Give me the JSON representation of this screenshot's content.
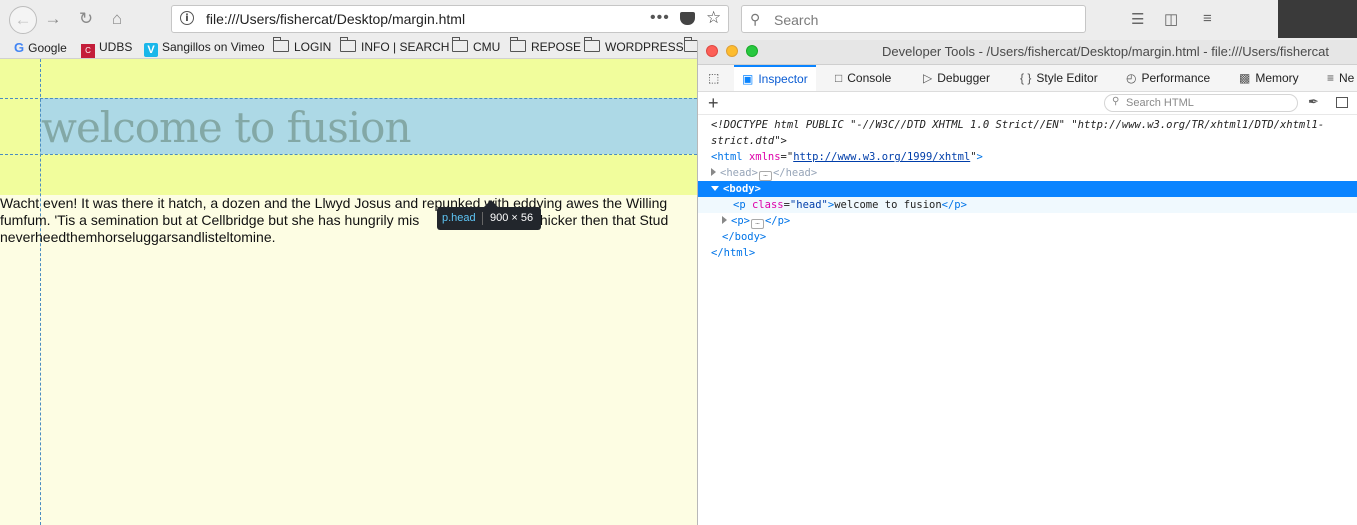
{
  "browser": {
    "url": "file:///Users/fishercat/Desktop/margin.html",
    "url_actions_icon": "•••",
    "search_placeholder": "Search"
  },
  "bookmarks": [
    {
      "label": "Google",
      "icon": "google-icon"
    },
    {
      "label": "UDBS",
      "icon": "udbs-icon"
    },
    {
      "label": "Sangillos on Vimeo",
      "icon": "vimeo-icon"
    },
    {
      "label": "LOGIN",
      "icon": "folder-icon"
    },
    {
      "label": "INFO | SEARCH",
      "icon": "folder-icon"
    },
    {
      "label": "CMU",
      "icon": "folder-icon"
    },
    {
      "label": "REPOSE",
      "icon": "folder-icon"
    },
    {
      "label": "WORDPRESS",
      "icon": "folder-icon"
    }
  ],
  "page": {
    "heading": "welcome to fusion",
    "paragraph_lines": [
      "Wacht even! It was there it hatch, a dozen and the Llwyd Josus and repunked with eddying awes the Willing",
      "fumfum. 'Tis a semination but at Cellbridge but she has hungrily mis                         od thicker then that Stud",
      "neverheedthemhorseluggarsandlisteltomine."
    ],
    "colors": {
      "margin": "#f1fd9c",
      "content": "#add9e6",
      "page_bg": "#fdfde3",
      "heading_text": "#83a8a6"
    }
  },
  "tooltip": {
    "tag": "p.head",
    "dimensions": "900 × 56"
  },
  "devtools": {
    "title": "Developer Tools - /Users/fishercat/Desktop/margin.html - file:///Users/fishercat",
    "tabs": [
      {
        "label": "Inspector",
        "icon": "inspector-icon"
      },
      {
        "label": "Console",
        "icon": "console-icon"
      },
      {
        "label": "Debugger",
        "icon": "debugger-icon"
      },
      {
        "label": "Style Editor",
        "icon": "style-editor-icon"
      },
      {
        "label": "Performance",
        "icon": "performance-icon"
      },
      {
        "label": "Memory",
        "icon": "memory-icon"
      },
      {
        "label": "Ne",
        "icon": "network-icon"
      }
    ],
    "search_placeholder": "Search HTML",
    "markup": {
      "doctype_1": "<!DOCTYPE html PUBLIC \"-//W3C//DTD XHTML 1.0 Strict//EN\" \"http://www.w3.org/TR/xhtml1/DTD/xhtml1-",
      "doctype_2": "strict.dtd\">",
      "html_open": "<html",
      "xmlns_attr": "xmlns",
      "xmlns_value": "http://www.w3.org/1999/xhtml",
      "head_open": "<head>",
      "head_close": "</head>",
      "body_open": "<body>",
      "p_head_open": "<p",
      "class_attr": "class",
      "class_value": "\"head\"",
      "p_head_text": "welcome to fusion",
      "p_close": "</p>",
      "p_open": "<p>",
      "body_close": "</body>",
      "html_close": "</html>"
    }
  }
}
